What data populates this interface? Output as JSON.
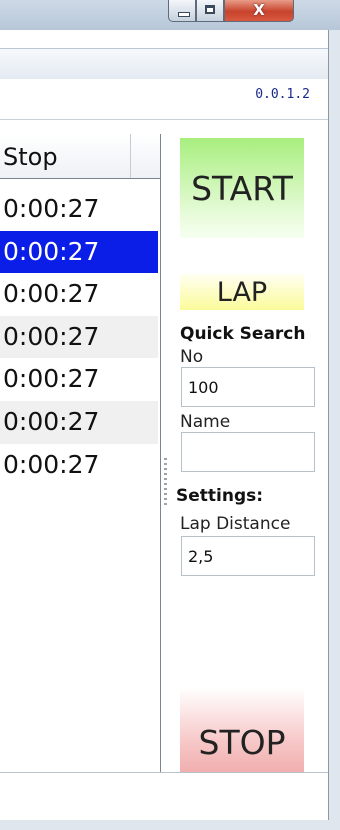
{
  "window": {
    "minimize_icon": "minimize-icon",
    "maximize_icon": "maximize-icon",
    "close_glyph": "X"
  },
  "version": "0.0.1.2",
  "list": {
    "header_stop": "Stop",
    "rows": [
      "0:00:27",
      "0:00:27",
      "0:00:27",
      "0:00:27",
      "0:00:27",
      "0:00:27",
      "0:00:27"
    ],
    "selected_row": 1
  },
  "panel": {
    "start_label": "START",
    "lap_label": "LAP",
    "quick_search_heading": "Quick Search",
    "no_label": "No",
    "no_value": "100",
    "name_label": "Name",
    "name_value": "",
    "settings_heading": "Settings:",
    "lap_distance_label": "Lap Distance",
    "lap_distance_value": "2,5",
    "stop_label": "STOP"
  },
  "colors": {
    "selection": "#0a1ee8",
    "version_text": "#1a2a8c",
    "start_green": "#a8ee7e",
    "lap_yellow": "#fbfb9a",
    "stop_red": "#ec9d9d"
  }
}
